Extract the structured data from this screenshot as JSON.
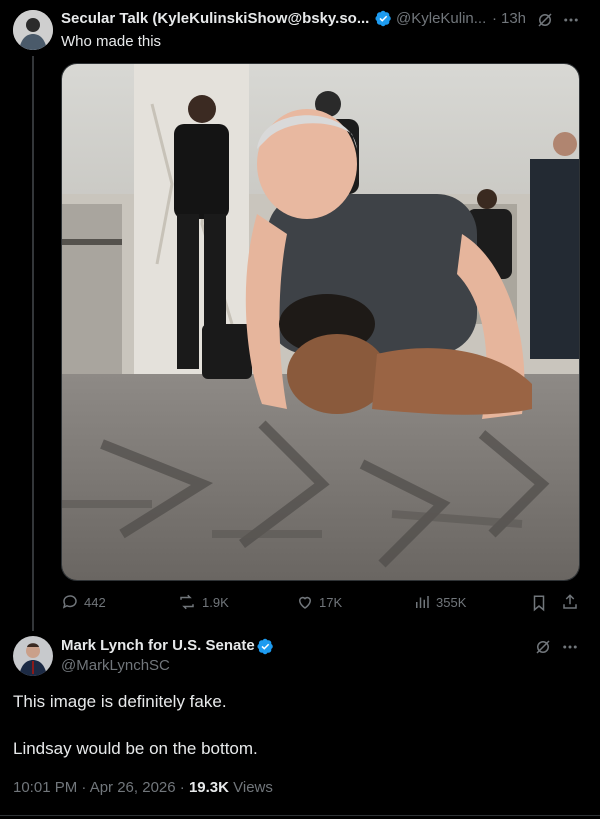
{
  "colors": {
    "accent": "#1d9bf0",
    "muted": "#71767b",
    "text": "#e7e9ea",
    "bg": "#000000"
  },
  "tweet1": {
    "display_name": "Secular Talk (KyleKulinskiShow@bsky.so...",
    "handle": "@KyleKulin...",
    "separator": "·",
    "time": "13h",
    "text": "Who made this",
    "verified_icon": "verified-badge-icon",
    "actions": {
      "replies": "442",
      "reposts": "1.9K",
      "likes": "17K",
      "views": "355K"
    }
  },
  "tweet2": {
    "display_name": "Mark Lynch for U.S. Senate",
    "handle": "@MarkLynchSC",
    "text_line1": "This image is definitely fake.",
    "text_line2": "Lindsay would be on the bottom.",
    "timestamp": "10:01 PM · Apr 26, 2026 · ",
    "views_count": "19.3K",
    "views_label": "Views"
  }
}
